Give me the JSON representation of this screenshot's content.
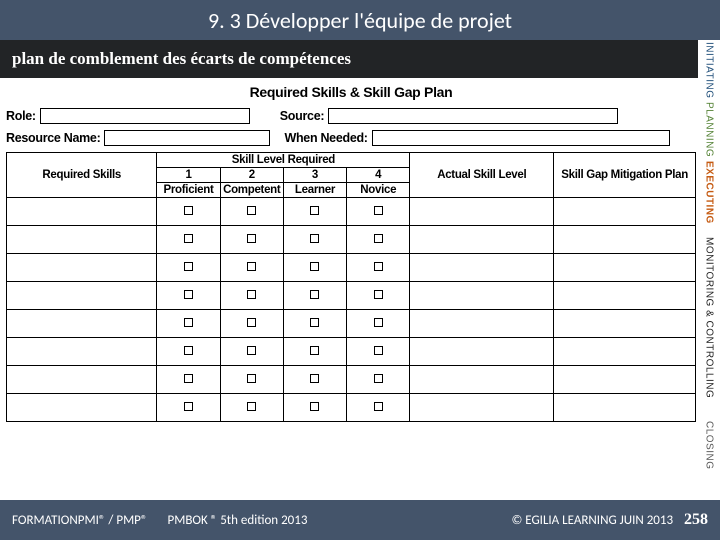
{
  "header": {
    "title": "9. 3 Développer l'équipe de projet"
  },
  "subtitle": "plan de comblement des écarts de compétences",
  "side_tabs": {
    "initiating": "INITIATING",
    "planning": "PLANNING",
    "executing": "EXECUTING",
    "monitoring": "MONITORING & CONTROLLING",
    "closing": "CLOSING"
  },
  "form": {
    "title": "Required Skills & Skill Gap Plan",
    "labels": {
      "role": "Role:",
      "source": "Source:",
      "resource_name": "Resource Name:",
      "when_needed": "When Needed:"
    },
    "table": {
      "headers": {
        "required_skills": "Required Skills",
        "skill_level_required": "Skill Level Required",
        "actual_skill_level": "Actual Skill Level",
        "plan": "Skill Gap Mitigation Plan"
      },
      "levels": {
        "n1": "1",
        "n2": "2",
        "n3": "3",
        "n4": "4",
        "l1": "Proficient",
        "l2": "Competent",
        "l3": "Learner",
        "l4": "Novice"
      },
      "row_count": 8
    }
  },
  "footer": {
    "left1": "FORMATIONPMI® / PMP®",
    "left2": "PMBOK ® 5th edition  2013",
    "right": "© EGILIA LEARNING  JUIN 2013",
    "page": "258"
  }
}
